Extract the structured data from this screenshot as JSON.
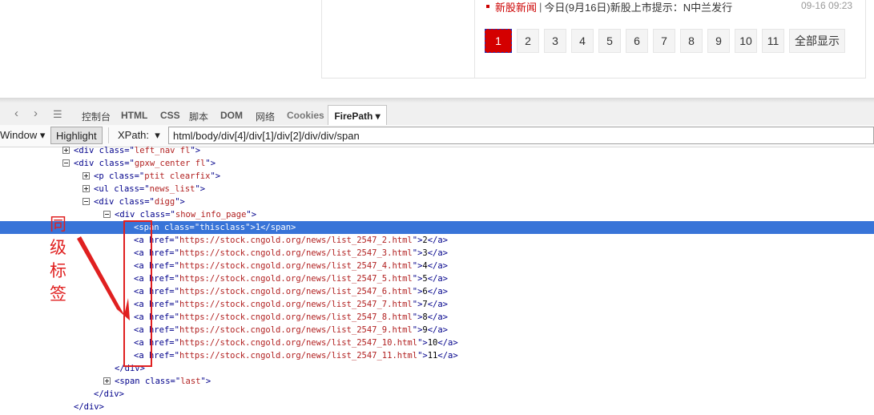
{
  "page": {
    "news": {
      "category": "新股新闻",
      "separator": "|",
      "title": "今日(9月16日)新股上市提示：N中兰发行",
      "date": "09-16 09:23"
    },
    "pager": {
      "pages": [
        "1",
        "2",
        "3",
        "4",
        "5",
        "6",
        "7",
        "8",
        "9",
        "10",
        "11"
      ],
      "active": "1",
      "show_all": "全部显示"
    }
  },
  "devtools": {
    "nav": {
      "back": "‹",
      "forward": "›",
      "menu": "☰"
    },
    "tabs": [
      "控制台",
      "HTML",
      "CSS",
      "脚本",
      "DOM",
      "网络",
      "Cookies"
    ],
    "active_tab": "FirePath ▾",
    "toolbar": {
      "window_label": "Window ▾",
      "highlight_label": "Highlight",
      "xpath_label": "XPath:",
      "xpath_dropdown": "▾",
      "xpath_value": "html/body/div[4]/div[1]/div[2]/div/div/span"
    }
  },
  "tree": [
    {
      "toggle": "plus",
      "open": "<div",
      "attr": "class",
      "val": "left_nav fl",
      "close": ">"
    },
    {
      "toggle": "minus",
      "open": "<div",
      "attr": "class",
      "val": "gpxw_center fl",
      "close": ">"
    },
    {
      "toggle": "plus",
      "open": "<p",
      "attr": "class",
      "val": "ptit clearfix",
      "close": ">"
    },
    {
      "toggle": "plus",
      "open": "<ul",
      "attr": "class",
      "val": "news_list",
      "close": ">"
    },
    {
      "toggle": "minus",
      "open": "<div",
      "attr": "class",
      "val": "digg",
      "close": ">"
    },
    {
      "toggle": "minus",
      "open": "<div",
      "attr": "class",
      "val": "show_info_page",
      "close": ">"
    },
    {
      "open": "<span",
      "attr": "class",
      "val": "thisclass",
      "close": ">",
      "text": "1",
      "end": "</span>",
      "selected": true
    },
    {
      "open": "<a",
      "attr": "href",
      "val": "https://stock.cngold.org/news/list_2547_2.html",
      "close": ">",
      "text": "2",
      "end": "</a>"
    },
    {
      "open": "<a",
      "attr": "href",
      "val": "https://stock.cngold.org/news/list_2547_3.html",
      "close": ">",
      "text": "3",
      "end": "</a>"
    },
    {
      "open": "<a",
      "attr": "href",
      "val": "https://stock.cngold.org/news/list_2547_4.html",
      "close": ">",
      "text": "4",
      "end": "</a>"
    },
    {
      "open": "<a",
      "attr": "href",
      "val": "https://stock.cngold.org/news/list_2547_5.html",
      "close": ">",
      "text": "5",
      "end": "</a>"
    },
    {
      "open": "<a",
      "attr": "href",
      "val": "https://stock.cngold.org/news/list_2547_6.html",
      "close": ">",
      "text": "6",
      "end": "</a>"
    },
    {
      "open": "<a",
      "attr": "href",
      "val": "https://stock.cngold.org/news/list_2547_7.html",
      "close": ">",
      "text": "7",
      "end": "</a>"
    },
    {
      "open": "<a",
      "attr": "href",
      "val": "https://stock.cngold.org/news/list_2547_8.html",
      "close": ">",
      "text": "8",
      "end": "</a>"
    },
    {
      "open": "<a",
      "attr": "href",
      "val": "https://stock.cngold.org/news/list_2547_9.html",
      "close": ">",
      "text": "9",
      "end": "</a>"
    },
    {
      "open": "<a",
      "attr": "href",
      "val": "https://stock.cngold.org/news/list_2547_10.html",
      "close": ">",
      "text": "10",
      "end": "</a>"
    },
    {
      "open": "<a",
      "attr": "href",
      "val": "https://stock.cngold.org/news/list_2547_11.html",
      "close": ">",
      "text": "11",
      "end": "</a>"
    },
    {
      "open": "</div>"
    },
    {
      "toggle": "plus",
      "open": "<span",
      "attr": "class",
      "val": "last",
      "close": ">"
    },
    {
      "open": "</div>"
    },
    {
      "open": "</div>"
    }
  ],
  "annotation": {
    "text": "同级标签",
    "color": "#e02020"
  },
  "colors": {
    "accent": "#d40000",
    "selection": "#3874d8",
    "tag": "#00008b",
    "attr_value": "#b22222"
  }
}
